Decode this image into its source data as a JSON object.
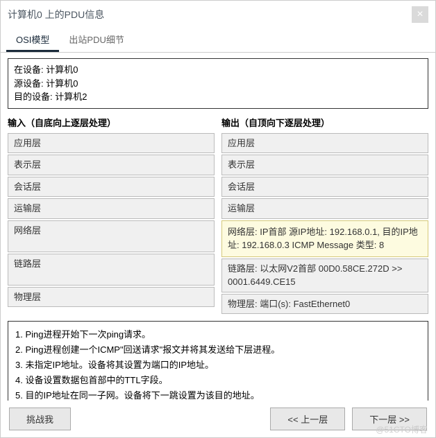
{
  "title": "计算机0 上的PDU信息",
  "tabs": {
    "osi": "OSI模型",
    "outbound": "出站PDU细节"
  },
  "device_info": {
    "at_device": "在设备: 计算机0",
    "src_device": "源设备: 计算机0",
    "dst_device": "目的设备: 计算机2"
  },
  "input_col": {
    "header": "输入（自底向上逐层处理）",
    "app": "应用层",
    "presentation": "表示层",
    "session": "会话层",
    "transport": "运输层",
    "network": "网络层",
    "link": "链路层",
    "physical": "物理层"
  },
  "output_col": {
    "header": "输出（自顶向下逐层处理）",
    "app": "应用层",
    "presentation": "表示层",
    "session": "会话层",
    "transport": "运输层",
    "network": "网络层: IP首部 源IP地址: 192.168.0.1, 目的IP地址: 192.168.0.3 ICMP Message 类型: 8",
    "link": "链路层: 以太网V2首部 00D0.58CE.272D >> 0001.6449.CE15",
    "physical": "物理层: 端口(s): FastEthernet0"
  },
  "notes": {
    "n1": "1. Ping进程开始下一次ping请求。",
    "n2": "2. Ping进程创建一个ICMP\"回送请求\"报文并将其发送给下层进程。",
    "n3": "3. 未指定IP地址。设备将其设置为端口的IP地址。",
    "n4": "4. 设备设置数据包首部中的TTL字段。",
    "n5": "5. 目的IP地址在同一子网。设备将下一跳设置为该目的地址。"
  },
  "buttons": {
    "challenge": "挑战我",
    "prev": "<< 上一层",
    "next": "下一层 >>"
  },
  "watermark": "@51CTO博客"
}
